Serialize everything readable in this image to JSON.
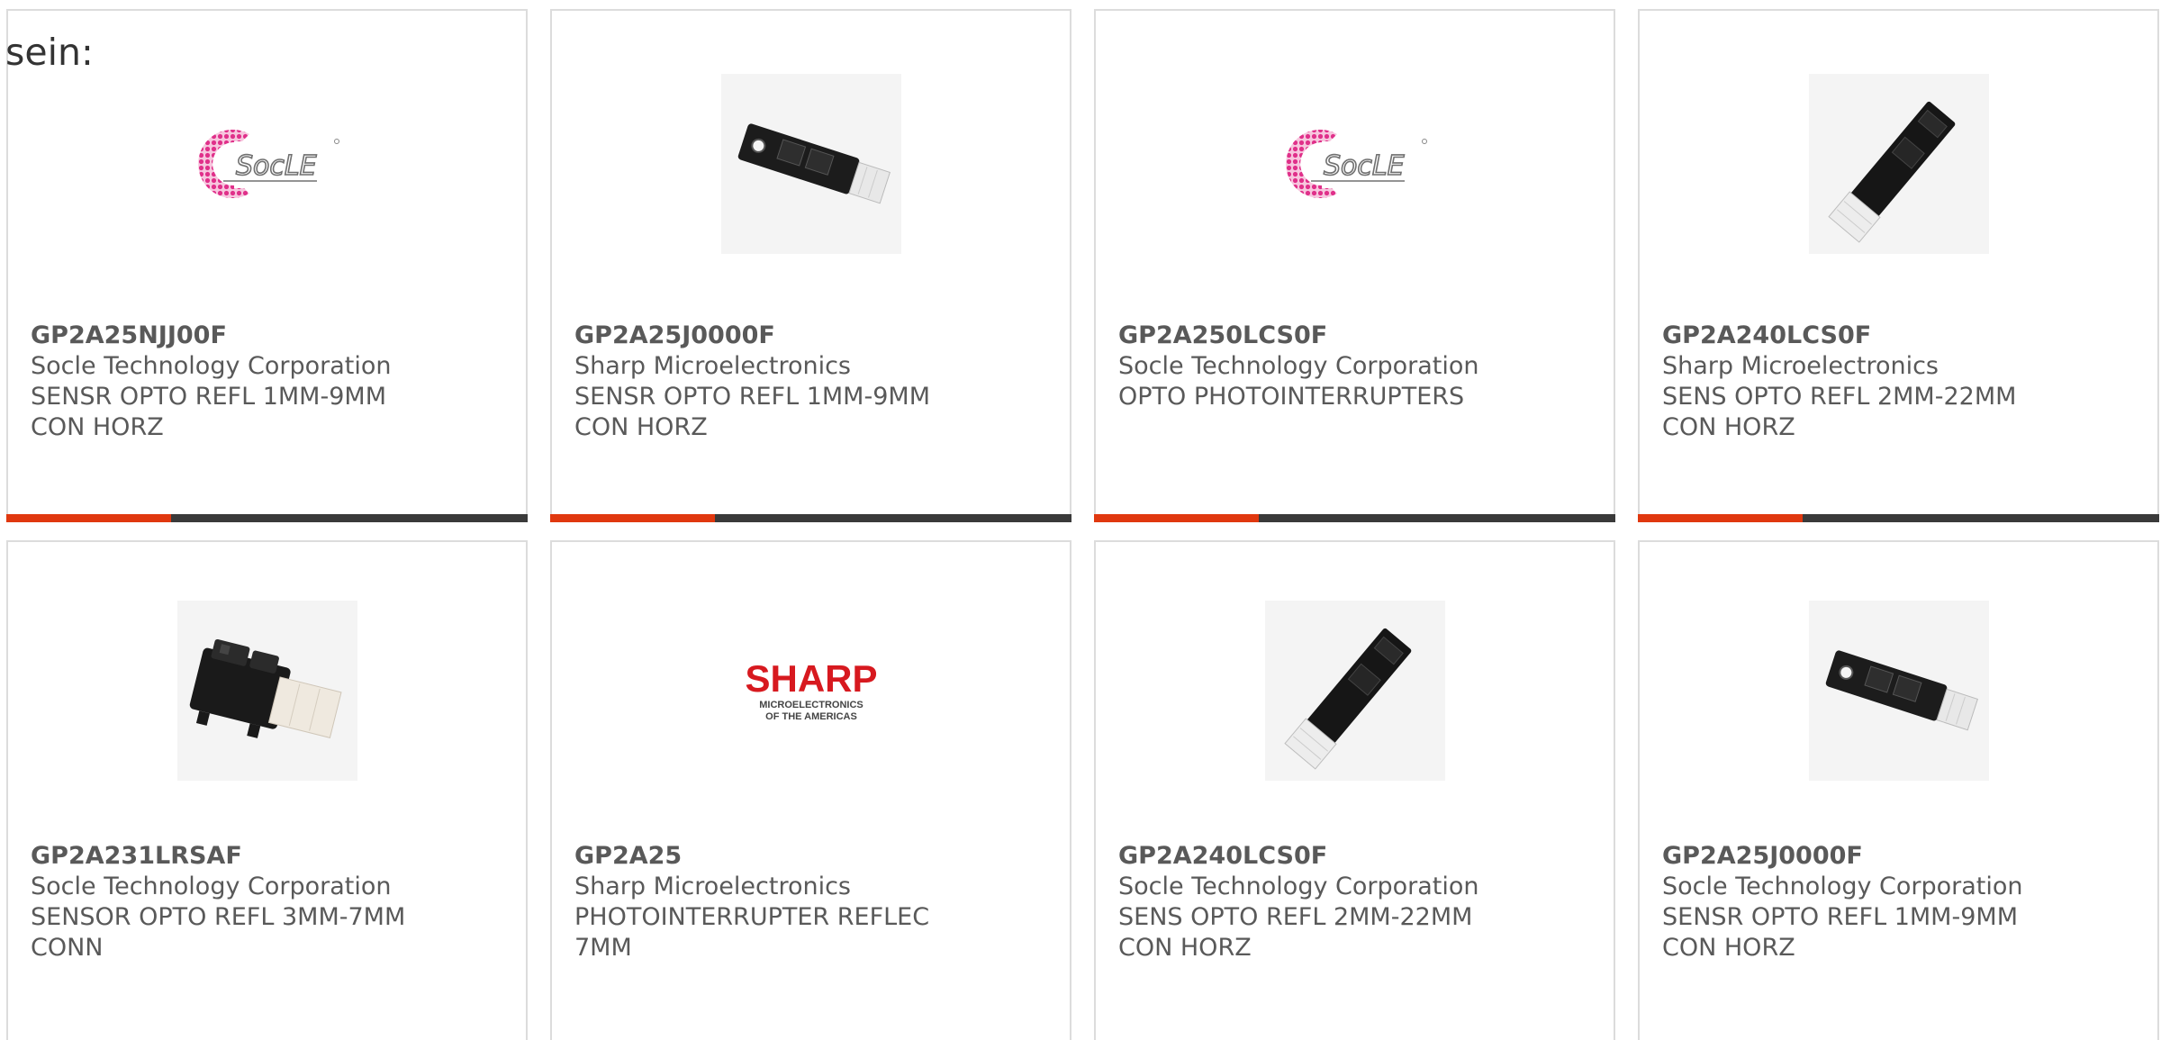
{
  "intro": {
    "text": "sein:"
  },
  "cards": [
    {
      "part_number": "GP2A25NJJ00F",
      "manufacturer": "Socle Technology Corporation",
      "description": "SENSR OPTO REFL 1MM-9MM CON HORZ",
      "image": "socle-logo"
    },
    {
      "part_number": "GP2A25J0000F",
      "manufacturer": "Sharp Microelectronics",
      "description": "SENSR OPTO REFL 1MM-9MM CON HORZ",
      "image": "sensor-flat-photo"
    },
    {
      "part_number": "GP2A250LCS0F",
      "manufacturer": "Socle Technology Corporation",
      "description": "OPTO PHOTOINTERRUPTERS",
      "image": "socle-logo"
    },
    {
      "part_number": "GP2A240LCS0F",
      "manufacturer": "Sharp Microelectronics",
      "description": "SENS OPTO REFL 2MM-22MM CON HORZ",
      "image": "sensor-diagonal-photo"
    },
    {
      "part_number": "GP2A231LRSAF",
      "manufacturer": "Socle Technology Corporation",
      "description": "SENSOR OPTO REFL 3MM-7MM CONN",
      "image": "sensor-connector-photo"
    },
    {
      "part_number": "GP2A25",
      "manufacturer": "Sharp Microelectronics",
      "description": "PHOTOINTERRUPTER REFLEC 7MM",
      "image": "sharp-logo"
    },
    {
      "part_number": "GP2A240LCS0F",
      "manufacturer": "Socle Technology Corporation",
      "description": "SENS OPTO REFL 2MM-22MM CON HORZ",
      "image": "sensor-diagonal-photo"
    },
    {
      "part_number": "GP2A25J0000F",
      "manufacturer": "Socle Technology Corporation",
      "description": "SENSR OPTO REFL 1MM-9MM CON HORZ",
      "image": "sensor-flat-photo"
    }
  ],
  "logos": {
    "socle_text": "SocLE",
    "sharp_text": "SHARP",
    "sharp_subtext_1": "MICROELECTRONICS",
    "sharp_subtext_2": "OF THE AMERICAS"
  },
  "colors": {
    "accent": "#e0380f",
    "bar": "#3a3a3a",
    "socle_pink": "#e0308a",
    "sharp_red": "#d7191f",
    "text": "#595959"
  }
}
